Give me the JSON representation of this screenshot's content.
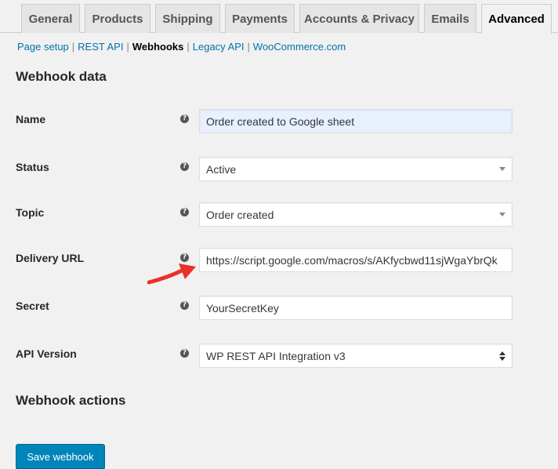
{
  "tabs": [
    {
      "label": "General"
    },
    {
      "label": "Products"
    },
    {
      "label": "Shipping"
    },
    {
      "label": "Payments"
    },
    {
      "label": "Accounts & Privacy"
    },
    {
      "label": "Emails"
    },
    {
      "label": "Advanced",
      "active": true
    }
  ],
  "subnav": {
    "page_setup": "Page setup",
    "rest_api": "REST API",
    "webhooks": "Webhooks",
    "legacy_api": "Legacy API",
    "woocommerce": "WooCommerce.com",
    "separator": "|"
  },
  "sections": {
    "webhook_data": "Webhook data",
    "webhook_actions": "Webhook actions"
  },
  "fields": {
    "name": {
      "label": "Name",
      "value": "Order created to Google sheet"
    },
    "status": {
      "label": "Status",
      "value": "Active"
    },
    "topic": {
      "label": "Topic",
      "value": "Order created"
    },
    "delivery_url": {
      "label": "Delivery URL",
      "value": "https://script.google.com/macros/s/AKfycbwd11sjWgaYbrQk"
    },
    "secret": {
      "label": "Secret",
      "value": "YourSecretKey"
    },
    "api_version": {
      "label": "API Version",
      "value": "WP REST API Integration v3"
    }
  },
  "help_glyph": "?",
  "save_button": "Save webhook",
  "colors": {
    "link": "#0073aa",
    "button": "#0085ba",
    "arrow": "#e8322b",
    "autofill": "#e8f0fe"
  },
  "icons": [
    "help-icon",
    "chevron-down-icon",
    "up-down-icon",
    "annotation-arrow-icon"
  ]
}
